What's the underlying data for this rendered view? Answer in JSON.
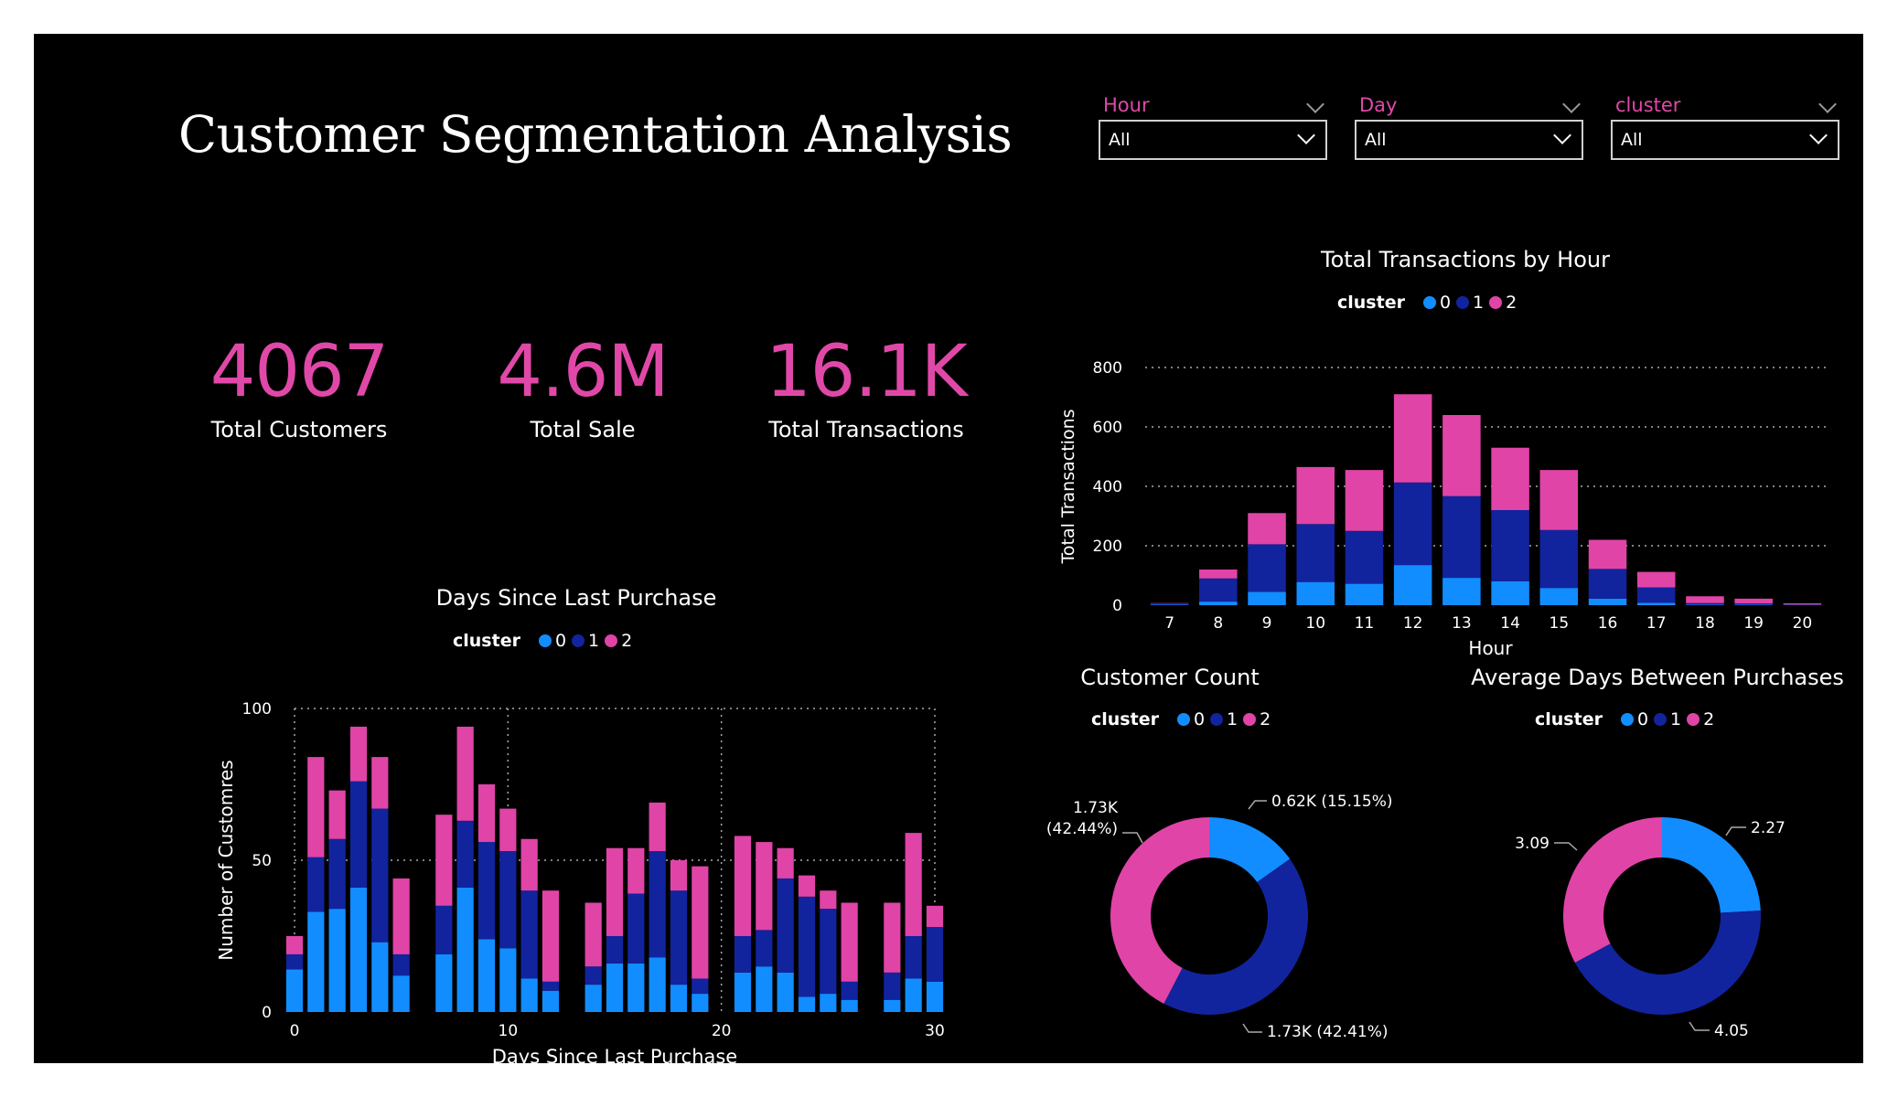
{
  "title": "Customer Segmentation Analysis",
  "filters": [
    {
      "label": "Hour",
      "value": "All"
    },
    {
      "label": "Day",
      "value": "All"
    },
    {
      "label": "cluster",
      "value": "All"
    }
  ],
  "kpis": [
    {
      "value": "4067",
      "label": "Total Customers"
    },
    {
      "value": "4.6M",
      "label": "Total Sale"
    },
    {
      "value": "16.1K",
      "label": "Total Transactions"
    }
  ],
  "colors": {
    "cluster0": "#118dff",
    "cluster1": "#12239e",
    "cluster2": "#e044a7",
    "accent": "#e048a8"
  },
  "legend": {
    "title": "cluster",
    "items": [
      "0",
      "1",
      "2"
    ]
  },
  "charts": {
    "hour_title": "Total Transactions by Hour",
    "hour_xlabel": "Hour",
    "hour_ylabel": "Total Transactions",
    "days_title": "Days Since Last Purchase",
    "days_xlabel": "Days Since Last Purchase",
    "days_ylabel": "Number of Customres",
    "count_title": "Customer Count",
    "avg_title": "Average Days Between Purchases"
  },
  "chart_data": [
    {
      "type": "bar",
      "stacked": true,
      "title": "Total Transactions by Hour",
      "xlabel": "Hour",
      "ylabel": "Total Transactions",
      "categories": [
        "7",
        "8",
        "9",
        "10",
        "11",
        "12",
        "13",
        "14",
        "15",
        "16",
        "17",
        "18",
        "19",
        "20"
      ],
      "ylim": [
        0,
        800
      ],
      "yticks": [
        0,
        200,
        400,
        600,
        800
      ],
      "series": [
        {
          "name": "0",
          "values": [
            2,
            12,
            45,
            78,
            72,
            135,
            92,
            80,
            58,
            22,
            8,
            2,
            2,
            1
          ]
        },
        {
          "name": "1",
          "values": [
            4,
            78,
            160,
            195,
            178,
            278,
            275,
            240,
            195,
            100,
            52,
            5,
            4,
            1
          ]
        },
        {
          "name": "2",
          "values": [
            1,
            30,
            105,
            192,
            205,
            297,
            273,
            210,
            202,
            98,
            52,
            23,
            16,
            4
          ]
        }
      ],
      "grid": true,
      "legend_position": "top"
    },
    {
      "type": "bar",
      "stacked": true,
      "title": "Days Since Last Purchase",
      "xlabel": "Days Since Last Purchase",
      "ylabel": "Number of Customres",
      "x": [
        0,
        1,
        2,
        3,
        4,
        5,
        7,
        8,
        9,
        10,
        11,
        12,
        14,
        15,
        16,
        17,
        18,
        19,
        21,
        22,
        23,
        24,
        25,
        26,
        28,
        29,
        30
      ],
      "ylim": [
        0,
        100
      ],
      "xlim": [
        0,
        30
      ],
      "xticks": [
        0,
        10,
        20,
        30
      ],
      "yticks": [
        0,
        50,
        100
      ],
      "series": [
        {
          "name": "0",
          "values": [
            14,
            33,
            34,
            41,
            23,
            12,
            19,
            41,
            24,
            21,
            11,
            7,
            9,
            16,
            16,
            18,
            9,
            6,
            13,
            15,
            13,
            5,
            6,
            4,
            4,
            11,
            10
          ]
        },
        {
          "name": "1",
          "values": [
            5,
            18,
            23,
            35,
            44,
            7,
            16,
            22,
            32,
            32,
            29,
            3,
            6,
            9,
            23,
            35,
            31,
            5,
            12,
            12,
            31,
            33,
            28,
            6,
            9,
            14,
            18
          ]
        },
        {
          "name": "2",
          "values": [
            6,
            33,
            16,
            18,
            17,
            25,
            30,
            31,
            19,
            14,
            17,
            30,
            21,
            29,
            15,
            16,
            10,
            37,
            33,
            29,
            10,
            7,
            6,
            26,
            23,
            34,
            7
          ]
        }
      ],
      "grid": true,
      "legend_position": "top"
    },
    {
      "type": "pie",
      "donut": true,
      "title": "Customer Count",
      "labels": [
        "0",
        "1",
        "2"
      ],
      "values": [
        0.62,
        1.73,
        1.73
      ],
      "percents": [
        15.15,
        42.41,
        42.44
      ],
      "data_labels": [
        "0.62K (15.15%)",
        "1.73K (42.41%)",
        "1.73K",
        "(42.44%)"
      ]
    },
    {
      "type": "pie",
      "donut": true,
      "title": "Average Days Between Purchases",
      "labels": [
        "0",
        "1",
        "2"
      ],
      "values": [
        2.27,
        4.05,
        3.09
      ],
      "data_labels": [
        "2.27",
        "4.05",
        "3.09"
      ]
    }
  ]
}
